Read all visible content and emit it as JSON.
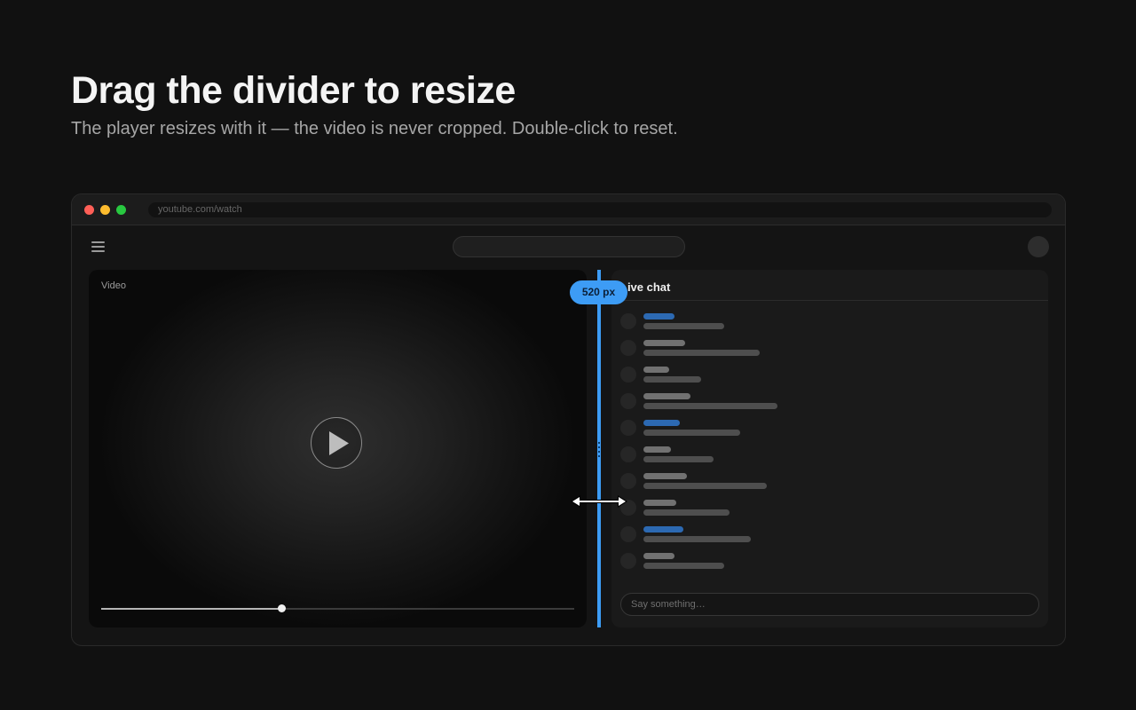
{
  "heading": {
    "title": "Drag the divider to resize",
    "subtitle": "The player resizes with it — the video is never cropped. Double-click to reset."
  },
  "browser": {
    "url": "youtube.com/watch"
  },
  "player": {
    "label": "Video",
    "progress_fraction": 0.38
  },
  "chat": {
    "title": "Live chat",
    "input_placeholder": "Say something…"
  },
  "divider": {
    "width_label": "520 px"
  },
  "colors": {
    "accent": "#3d9cf5",
    "background": "#111111",
    "window_close": "#ff5f57",
    "window_minimize": "#febc2e",
    "window_zoom": "#28c840"
  }
}
